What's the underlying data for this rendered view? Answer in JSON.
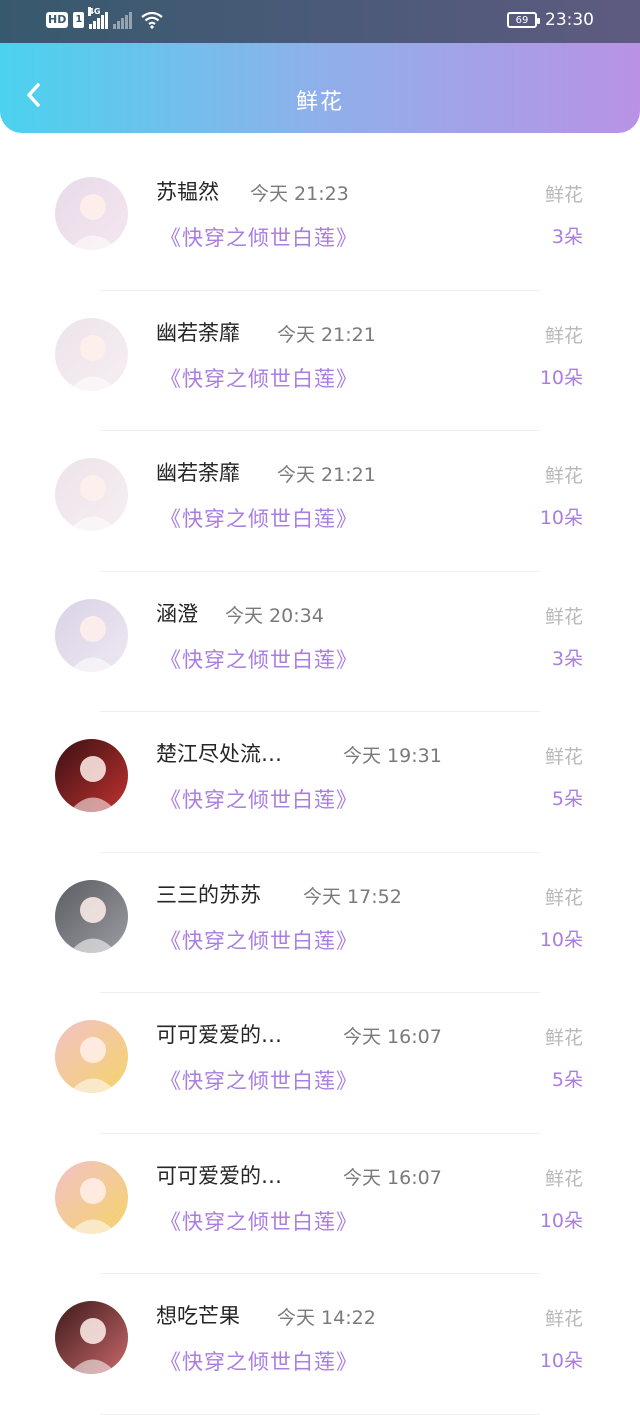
{
  "status_bar": {
    "hd_label": "HD",
    "sim_label": "1",
    "network_label": "4G",
    "battery_level": "69",
    "time": "23:30"
  },
  "header": {
    "title": "鲜花",
    "back_icon": "chevron-left-icon"
  },
  "items": [
    {
      "name": "苏韫然",
      "time": "今天 21:23",
      "book": "《快穿之倾世白莲》",
      "gift_type": "鲜花",
      "gift_count": "3朵",
      "avatar_colors": [
        "#e8dbe9",
        "#f4e7f0"
      ]
    },
    {
      "name": "幽若荼靡",
      "time": "今天 21:21",
      "book": "《快穿之倾世白莲》",
      "gift_type": "鲜花",
      "gift_count": "10朵",
      "avatar_colors": [
        "#ece4ea",
        "#f7eef2"
      ]
    },
    {
      "name": "幽若荼靡",
      "time": "今天 21:21",
      "book": "《快穿之倾世白莲》",
      "gift_type": "鲜花",
      "gift_count": "10朵",
      "avatar_colors": [
        "#ece4ea",
        "#f7eef2"
      ]
    },
    {
      "name": "涵澄",
      "time": "今天 20:34",
      "book": "《快穿之倾世白莲》",
      "gift_type": "鲜花",
      "gift_count": "3朵",
      "avatar_colors": [
        "#d8d2e6",
        "#efe8f2"
      ]
    },
    {
      "name": "楚江尽处流…",
      "time": "今天 19:31",
      "book": "《快穿之倾世白莲》",
      "gift_type": "鲜花",
      "gift_count": "5朵",
      "avatar_colors": [
        "#3a1014",
        "#c0322f"
      ]
    },
    {
      "name": "三三的苏苏",
      "time": "今天 17:52",
      "book": "《快穿之倾世白莲》",
      "gift_type": "鲜花",
      "gift_count": "10朵",
      "avatar_colors": [
        "#5b5d63",
        "#9a9ca2"
      ]
    },
    {
      "name": "可可爱爱的…",
      "time": "今天 16:07",
      "book": "《快穿之倾世白莲》",
      "gift_type": "鲜花",
      "gift_count": "5朵",
      "avatar_colors": [
        "#f2c1c6",
        "#f5d46a"
      ]
    },
    {
      "name": "可可爱爱的…",
      "time": "今天 16:07",
      "book": "《快穿之倾世白莲》",
      "gift_type": "鲜花",
      "gift_count": "10朵",
      "avatar_colors": [
        "#f2c1c6",
        "#f5d46a"
      ]
    },
    {
      "name": "想吃芒果",
      "time": "今天 14:22",
      "book": "《快穿之倾世白莲》",
      "gift_type": "鲜花",
      "gift_count": "10朵",
      "avatar_colors": [
        "#3d1a1b",
        "#c9686a"
      ]
    }
  ]
}
